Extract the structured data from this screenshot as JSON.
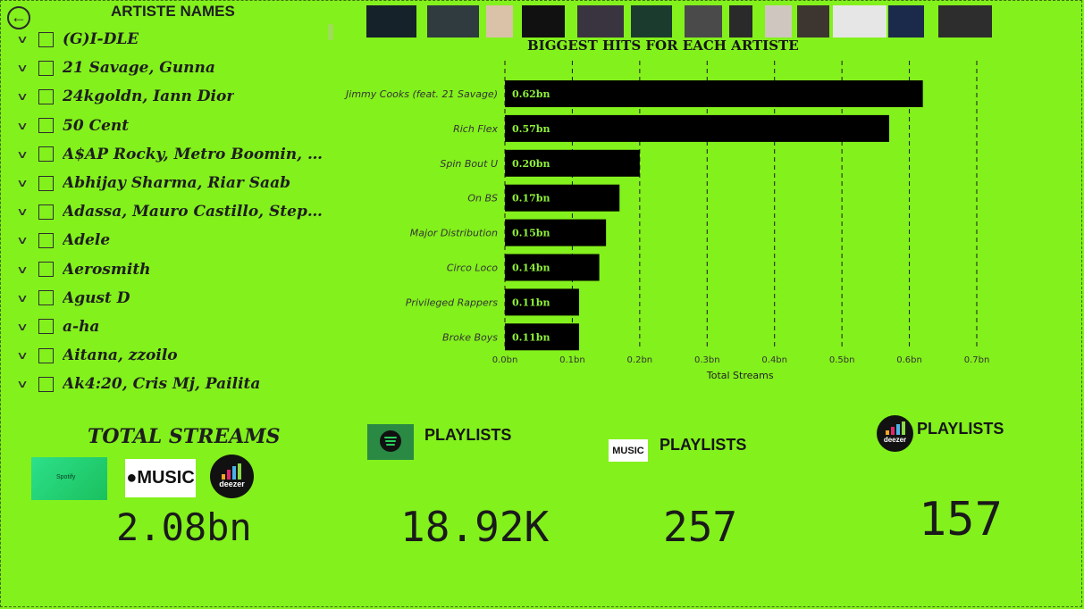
{
  "slicer": {
    "title": "ARTISTE NAMES",
    "items": [
      {
        "label": "(G)I-DLE"
      },
      {
        "label": "21 Savage, Gunna"
      },
      {
        "label": "24kgoldn, Iann Dior"
      },
      {
        "label": "50 Cent"
      },
      {
        "label": "A$AP Rocky, Metro Boomin, Roisee"
      },
      {
        "label": "Abhijay Sharma, Riar Saab"
      },
      {
        "label": "Adassa, Mauro Castillo, Stephanie ..."
      },
      {
        "label": "Adele"
      },
      {
        "label": "Aerosmith"
      },
      {
        "label": "Agust D"
      },
      {
        "label": "a-ha"
      },
      {
        "label": "Aitana, zzoilo"
      },
      {
        "label": "Ak4:20, Cris Mj, Pailita"
      }
    ]
  },
  "thumbnails": [
    {
      "color": "#15222a"
    },
    {
      "color": "#2f3b3f"
    },
    {
      "color": "#d9c2a8"
    },
    {
      "color": "#111111"
    },
    {
      "color": "#3a3440"
    },
    {
      "color": "#1c3b2f"
    },
    {
      "color": "#4a4a4a"
    },
    {
      "color": "#2a2a2a"
    },
    {
      "color": "#cfc7bf"
    },
    {
      "color": "#3d3630"
    },
    {
      "color": "#e6e6e6"
    },
    {
      "color": "#1b2a4a"
    },
    {
      "color": "#2d2d2d"
    }
  ],
  "chart_data": {
    "type": "bar",
    "orientation": "horizontal",
    "title": "BIGGEST HITS FOR EACH ARTISTE",
    "xlabel": "Total Streams",
    "ylabel": "",
    "categories": [
      "Jimmy Cooks (feat. 21 Savage)",
      "Rich Flex",
      "Spin Bout U",
      "On BS",
      "Major Distribution",
      "Circo Loco",
      "Privileged Rappers",
      "Broke Boys"
    ],
    "values": [
      0.62,
      0.57,
      0.2,
      0.17,
      0.15,
      0.14,
      0.11,
      0.11
    ],
    "data_labels": [
      "0.62bn",
      "0.57bn",
      "0.20bn",
      "0.17bn",
      "0.15bn",
      "0.14bn",
      "0.11bn",
      "0.11bn"
    ],
    "xlim": [
      0,
      0.7
    ],
    "xticks": [
      0,
      0.1,
      0.2,
      0.3,
      0.4,
      0.5,
      0.6,
      0.7
    ],
    "xtick_labels": [
      "0.0bn",
      "0.1bn",
      "0.2bn",
      "0.3bn",
      "0.4bn",
      "0.5bn",
      "0.6bn",
      "0.7bn"
    ],
    "grid": true,
    "bar_color": "#000000",
    "label_color": "#8ff23a"
  },
  "kpis": {
    "total_streams": {
      "title": "TOTAL STREAMS",
      "value": "2.08bn"
    },
    "spotify_playlists": {
      "label": "PLAYLISTS",
      "value": "18.92K"
    },
    "apple_playlists": {
      "label": "PLAYLISTS",
      "value": "257"
    },
    "deezer_playlists": {
      "label": "PLAYLISTS",
      "value": "157"
    }
  },
  "logos": {
    "spotify_mini": "Spotify",
    "apple": "MUSIC",
    "deezer": "deezer"
  },
  "colors": {
    "background": "#83f11c",
    "bar": "#000000",
    "bar_label": "#8ff23a"
  }
}
